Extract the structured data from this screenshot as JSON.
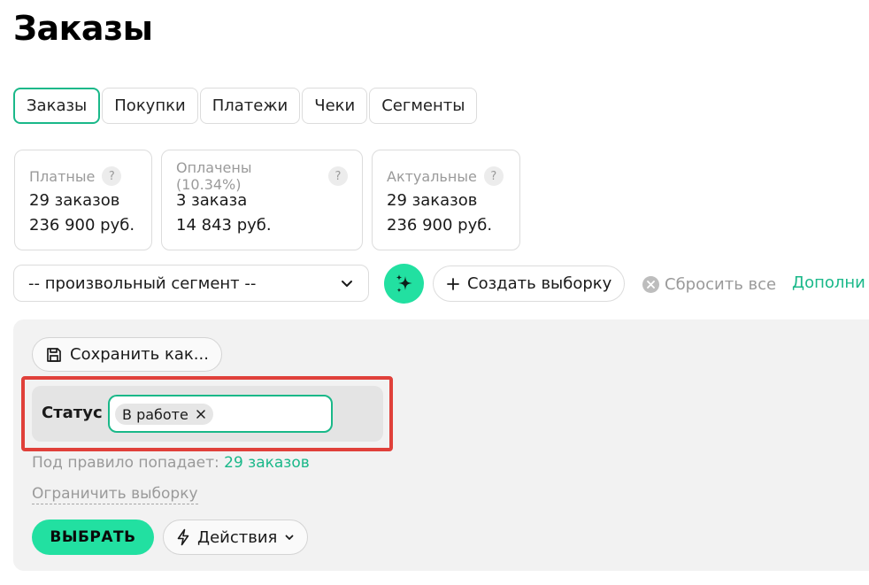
{
  "page": {
    "title": "Заказы"
  },
  "tabs": [
    {
      "label": "Заказы",
      "active": true
    },
    {
      "label": "Покупки",
      "active": false
    },
    {
      "label": "Платежи",
      "active": false
    },
    {
      "label": "Чеки",
      "active": false
    },
    {
      "label": "Сегменты",
      "active": false
    }
  ],
  "stats": [
    {
      "title": "Платные",
      "help": "?",
      "count": "29 заказов",
      "amount": "236 900 руб."
    },
    {
      "title": "Оплачены (10.34%)",
      "help": "?",
      "count": "3 заказа",
      "amount": "14 843 руб."
    },
    {
      "title": "Актуальные",
      "help": "?",
      "count": "29 заказов",
      "amount": "236 900 руб."
    }
  ],
  "toolbar": {
    "segment_value": "-- произвольный сегмент --",
    "create_label": "Создать выборку",
    "reset_label": "Сбросить все",
    "more_label": "Дополни"
  },
  "filter": {
    "save_as_label": "Сохранить как...",
    "status_label": "Статус",
    "status_chip": "В работе",
    "rule_prefix": "Под правило попадает:",
    "rule_count": "29 заказов",
    "limit_label": "Ограничить выборку",
    "select_label": "ВЫБРАТЬ",
    "actions_label": "Действия"
  },
  "colors": {
    "accent": "#22e0a1",
    "accent_text": "#1ab889",
    "highlight": "#e0403a",
    "panel_bg": "#f2f2f2"
  },
  "icons": {
    "segment_select": "chevron-down-icon",
    "ai_button": "sparkles-icon",
    "create_button": "plus-icon",
    "reset_button": "x-circle-icon",
    "save_as_button": "floppy-disk-icon",
    "chip_remove": "close-icon",
    "actions_button": "lightning-icon",
    "actions_dropdown": "chevron-down-icon"
  }
}
